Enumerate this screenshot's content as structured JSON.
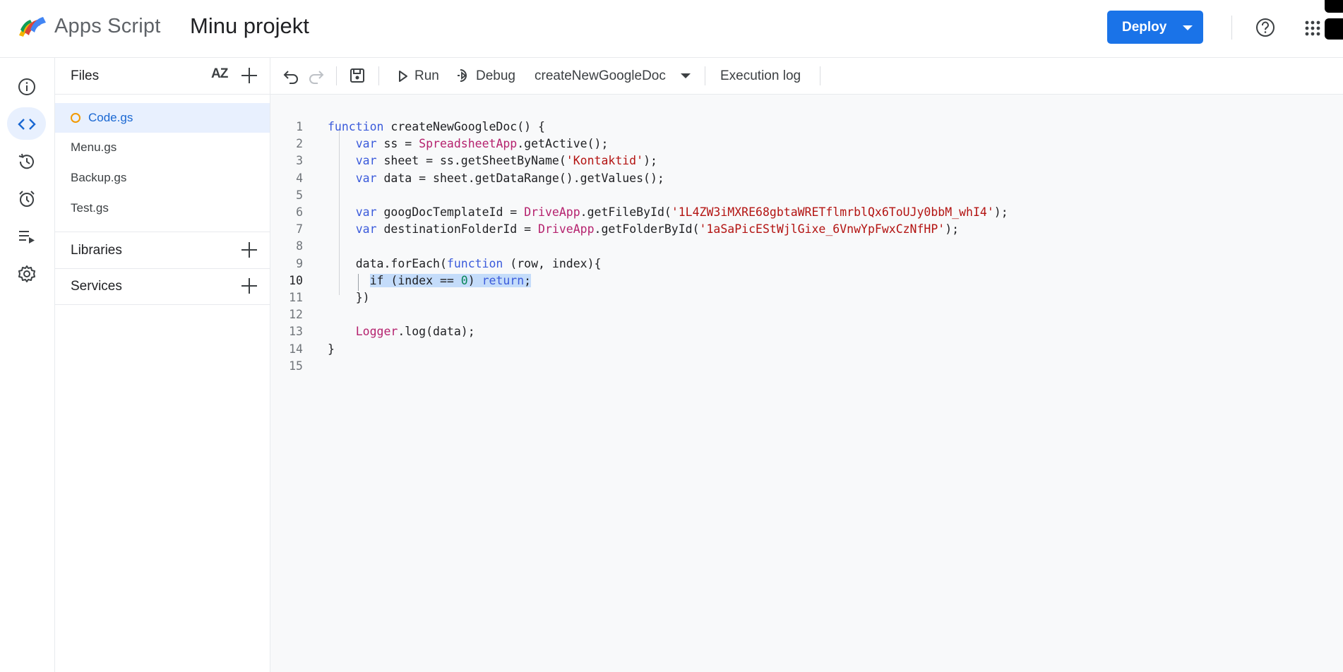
{
  "header": {
    "app_name": "Apps Script",
    "project_name": "Minu projekt",
    "deploy_label": "Deploy"
  },
  "files_panel": {
    "title": "Files",
    "sort_label": "AZ",
    "files": [
      {
        "name": "Code.gs",
        "active": true,
        "unsaved": true
      },
      {
        "name": "Menu.gs"
      },
      {
        "name": "Backup.gs"
      },
      {
        "name": "Test.gs"
      }
    ],
    "libraries_label": "Libraries",
    "services_label": "Services"
  },
  "toolbar": {
    "run_label": "Run",
    "debug_label": "Debug",
    "function_select": "createNewGoogleDoc",
    "execution_log_label": "Execution log"
  },
  "left_nav": [
    "overview-icon",
    "editor-icon",
    "history-icon",
    "triggers-icon",
    "executions-icon",
    "settings-icon"
  ],
  "editor": {
    "current_line": 10,
    "lines": [
      "function createNewGoogleDoc() {",
      "    var ss = SpreadsheetApp.getActive();",
      "    var sheet = ss.getSheetByName('Kontaktid');",
      "    var data = sheet.getDataRange().getValues();",
      "",
      "    var googDocTemplateId = DriveApp.getFileById('1L4ZW3iMXRE68gbtaWRETflmrblQx6ToUJy0bbM_whI4');",
      "    var destinationFolderId = DriveApp.getFolderById('1aSaPicEStWjlGixe_6VnwYpFwxCzNfHP');",
      "",
      "    data.forEach(function (row, index){",
      "      if (index == 0) return;",
      "    })",
      "",
      "    Logger.log(data);",
      "}",
      ""
    ]
  },
  "colors": {
    "accent": "#1a73e8",
    "keyword": "#3b5bdb",
    "object": "#b5226e",
    "string": "#b31412",
    "selection": "#c4dcfa"
  }
}
